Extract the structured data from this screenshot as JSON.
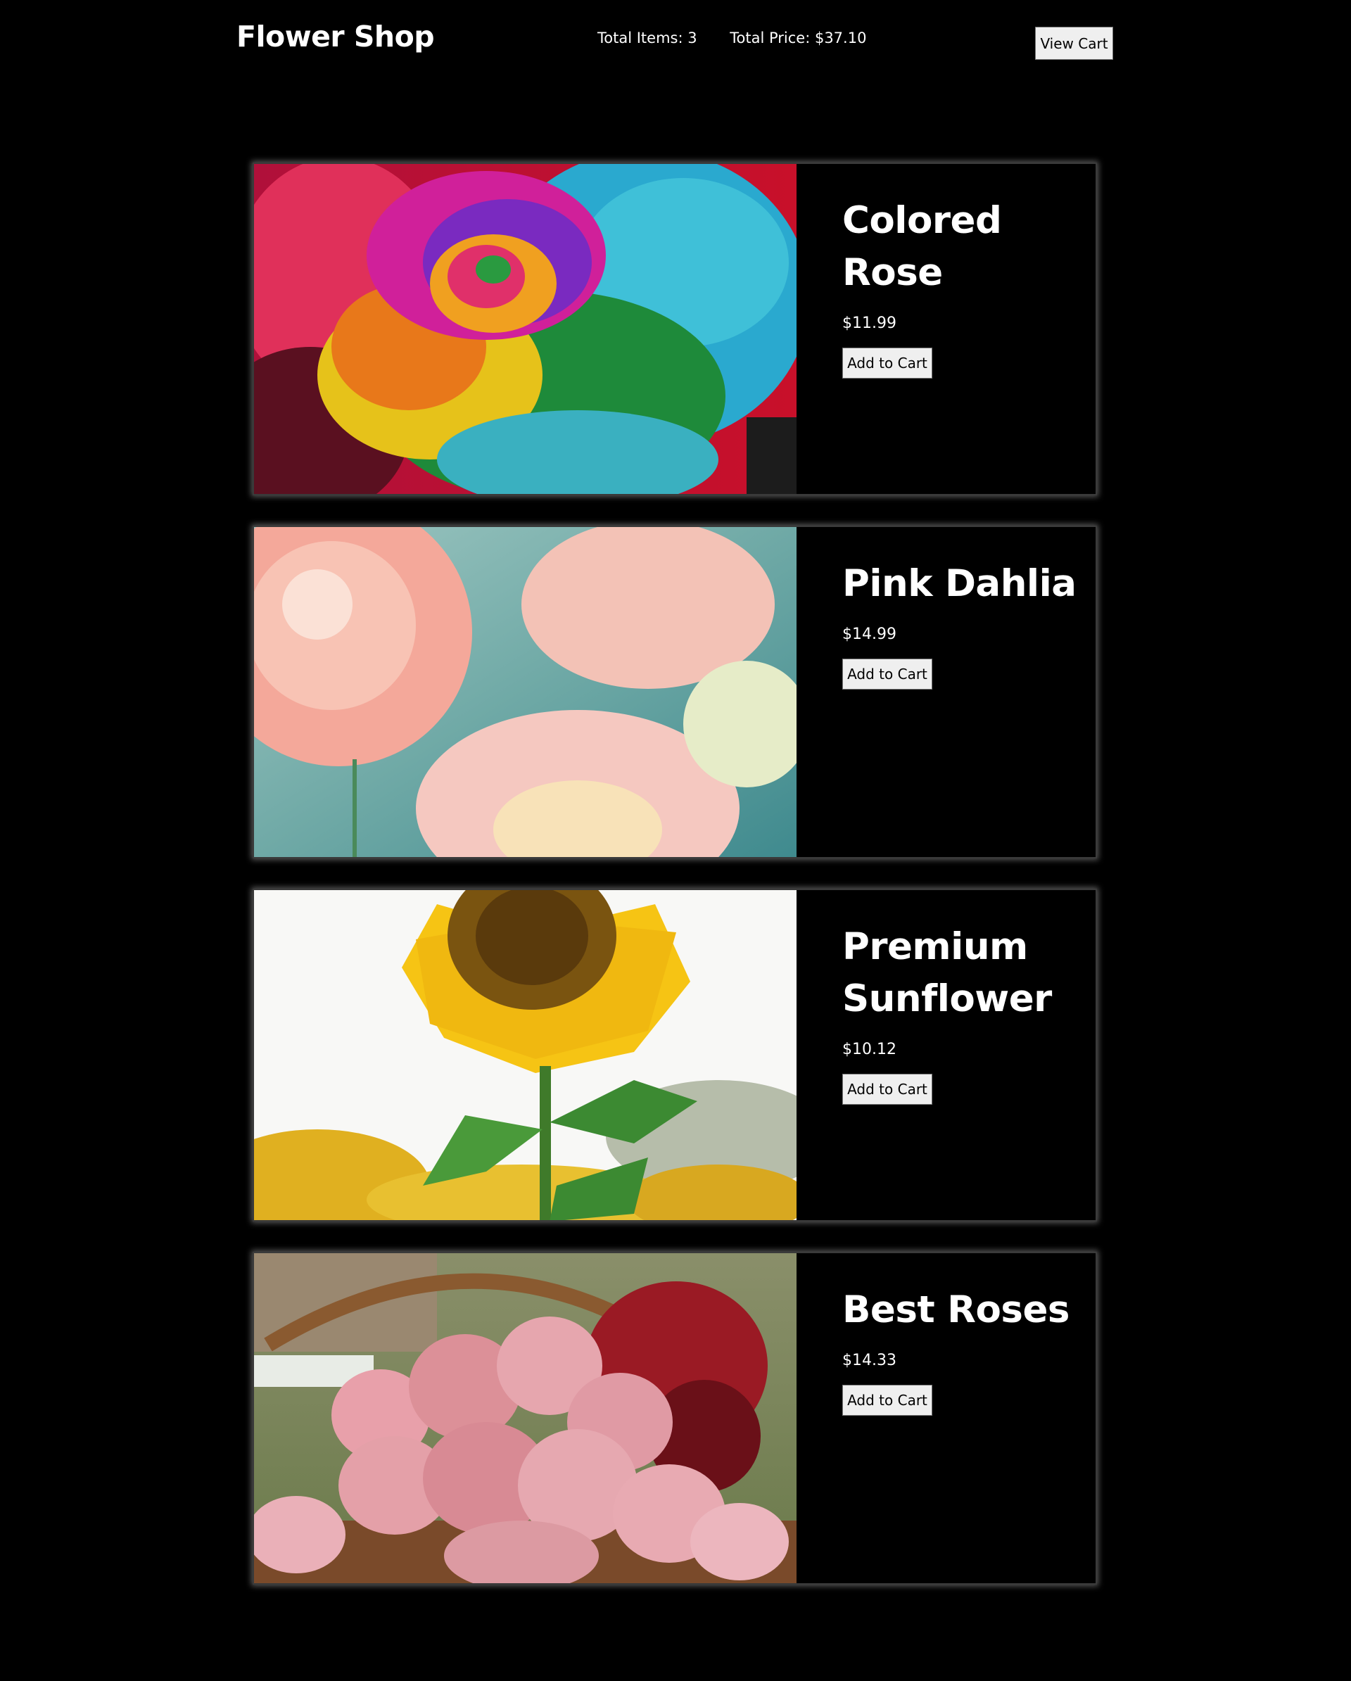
{
  "header": {
    "brand": "Flower Shop",
    "total_items": "Total Items: 3",
    "total_price": "Total Price: $37.10",
    "view_cart_label": "View Cart"
  },
  "products": [
    {
      "name": "Colored Rose",
      "price": "$11.99",
      "button_label": "Add to Cart",
      "image": "rainbow-rose-photo"
    },
    {
      "name": "Pink Dahlia",
      "price": "$14.99",
      "button_label": "Add to Cart",
      "image": "pink-dahlia-photo"
    },
    {
      "name": "Premium Sunflower",
      "price": "$10.12",
      "button_label": "Add to Cart",
      "image": "sunflower-photo"
    },
    {
      "name": "Best Roses",
      "price": "$14.33",
      "button_label": "Add to Cart",
      "image": "rose-basket-photo"
    }
  ],
  "colors": {
    "background": "#000000",
    "text": "#ffffff",
    "button": "#efefef"
  }
}
